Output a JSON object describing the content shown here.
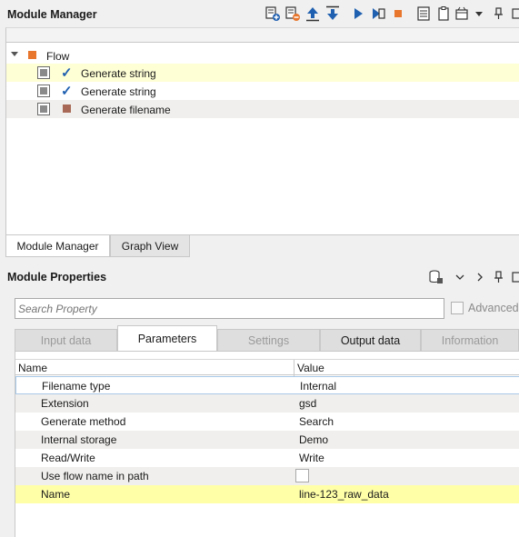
{
  "module_manager": {
    "title": "Module Manager",
    "toolbar_icons": [
      "add-module-icon",
      "remove-module-icon",
      "move-up-icon",
      "move-down-icon",
      "run-icon",
      "step-run-icon",
      "stop-icon",
      "list-icon",
      "clipboard-icon",
      "window-menu-icon",
      "chevron-down-icon",
      "pin-icon"
    ],
    "tree": {
      "root": "Flow",
      "items": [
        {
          "label": "Generate string",
          "status": "checked",
          "selected": true
        },
        {
          "label": "Generate string",
          "status": "checked",
          "selected": false
        },
        {
          "label": "Generate filename",
          "status": "pending",
          "selected": false
        }
      ]
    },
    "tabs": [
      {
        "label": "Module Manager",
        "active": true
      },
      {
        "label": "Graph View",
        "active": false
      }
    ]
  },
  "module_properties": {
    "title": "Module Properties",
    "toolbar_icons": [
      "database-icon",
      "chevron-down-icon",
      "chevron-right-icon",
      "pin-icon"
    ],
    "search_placeholder": "Search Property",
    "advanced_label": "Advanced",
    "tabs": [
      {
        "label": "Input data",
        "active": false
      },
      {
        "label": "Parameters",
        "active": true
      },
      {
        "label": "Settings",
        "active": false
      },
      {
        "label": "Output data",
        "active": false
      },
      {
        "label": "Information",
        "active": false
      }
    ],
    "columns": {
      "name": "Name",
      "value": "Value"
    },
    "rows": [
      {
        "name": "Filename type",
        "value": "Internal"
      },
      {
        "name": "Extension",
        "value": "gsd"
      },
      {
        "name": "Generate method",
        "value": "Search"
      },
      {
        "name": "Internal storage",
        "value": "Demo"
      },
      {
        "name": "Read/Write",
        "value": "Write"
      },
      {
        "name": "Use flow name in path",
        "value": ""
      },
      {
        "name": "Name",
        "value": "line-123_raw_data"
      }
    ]
  },
  "colors": {
    "accent_blue": "#2060b0",
    "flow_orange": "#e8762d",
    "stop_orange": "#e8762d",
    "selected_row": "#ffffa8"
  }
}
